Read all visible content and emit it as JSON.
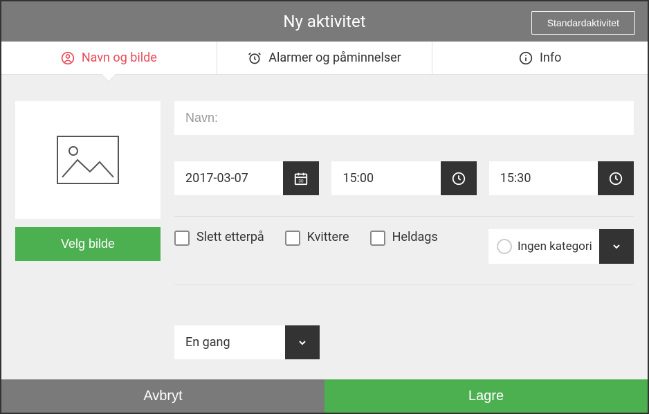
{
  "header": {
    "title": "Ny aktivitet",
    "standard_button": "Standardaktivitet"
  },
  "tabs": {
    "name_image": "Navn og bilde",
    "alarms": "Alarmer og påminnelser",
    "info": "Info"
  },
  "form": {
    "choose_image": "Velg bilde",
    "name_placeholder": "Navn:",
    "date_value": "2017-03-07",
    "time_start": "15:00",
    "time_end": "15:30",
    "delete_after": "Slett etterpå",
    "receipt": "Kvittere",
    "all_day": "Heldags",
    "category_label": "Ingen kategori",
    "recurrence": "En gang"
  },
  "footer": {
    "cancel": "Avbryt",
    "save": "Lagre"
  }
}
